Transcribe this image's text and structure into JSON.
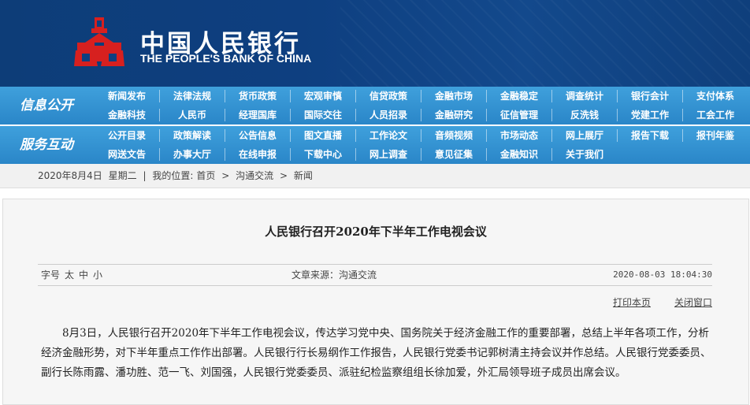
{
  "header": {
    "bank_name_cn": "中国人民银行",
    "bank_name_en": "THE PEOPLE'S BANK OF CHINA",
    "emblem_icon": "pboc-emblem-icon",
    "colors": {
      "banner": "#0e3f80",
      "nav": "#2a86c8",
      "emblem": "#d7201f"
    }
  },
  "nav": {
    "info": {
      "title": "信息公开",
      "row1": [
        "新闻发布",
        "法律法规",
        "货币政策",
        "宏观审慎",
        "信贷政策",
        "金融市场",
        "金融稳定",
        "调查统计",
        "银行会计",
        "支付体系"
      ],
      "row2": [
        "金融科技",
        "人民币",
        "经理国库",
        "国际交往",
        "人员招录",
        "金融研究",
        "征信管理",
        "反洗钱",
        "党建工作",
        "工会工作"
      ]
    },
    "service": {
      "title": "服务互动",
      "row1": [
        "公开目录",
        "政策解读",
        "公告信息",
        "图文直播",
        "工作论文",
        "音频视频",
        "市场动态",
        "网上展厅",
        "报告下载",
        "报刊年鉴"
      ],
      "row2": [
        "网送文告",
        "办事大厅",
        "在线申报",
        "下载中心",
        "网上调查",
        "意见征集",
        "金融知识",
        "关于我们"
      ]
    }
  },
  "breadcrumb": {
    "date": "2020年8月4日",
    "weekday": "星期二",
    "sep": "|",
    "location_label": "我的位置:",
    "home": "首页",
    "arrow1": ">",
    "section": "沟通交流",
    "arrow2": ">",
    "page": "新闻"
  },
  "article": {
    "title": "人民银行召开2020年下半年工作电视会议",
    "font_size_label": "字号",
    "font_sizes": [
      "太",
      "中",
      "小"
    ],
    "source": "文章来源：沟通交流",
    "datetime": "2020-08-03 18:04:30",
    "print_label": "打印本页",
    "close_label": "关闭窗口",
    "body": "8月3日，人民银行召开2020年下半年工作电视会议，传达学习党中央、国务院关于经济金融工作的重要部署，总结上半年各项工作，分析经济金融形势，对下半年重点工作作出部署。人民银行行长易纲作工作报告，人民银行党委书记郭树清主持会议并作总结。人民银行党委委员、副行长陈雨露、潘功胜、范一飞、刘国强，人民银行党委委员、派驻纪检监察组组长徐加爱，外汇局领导班子成员出席会议。"
  }
}
